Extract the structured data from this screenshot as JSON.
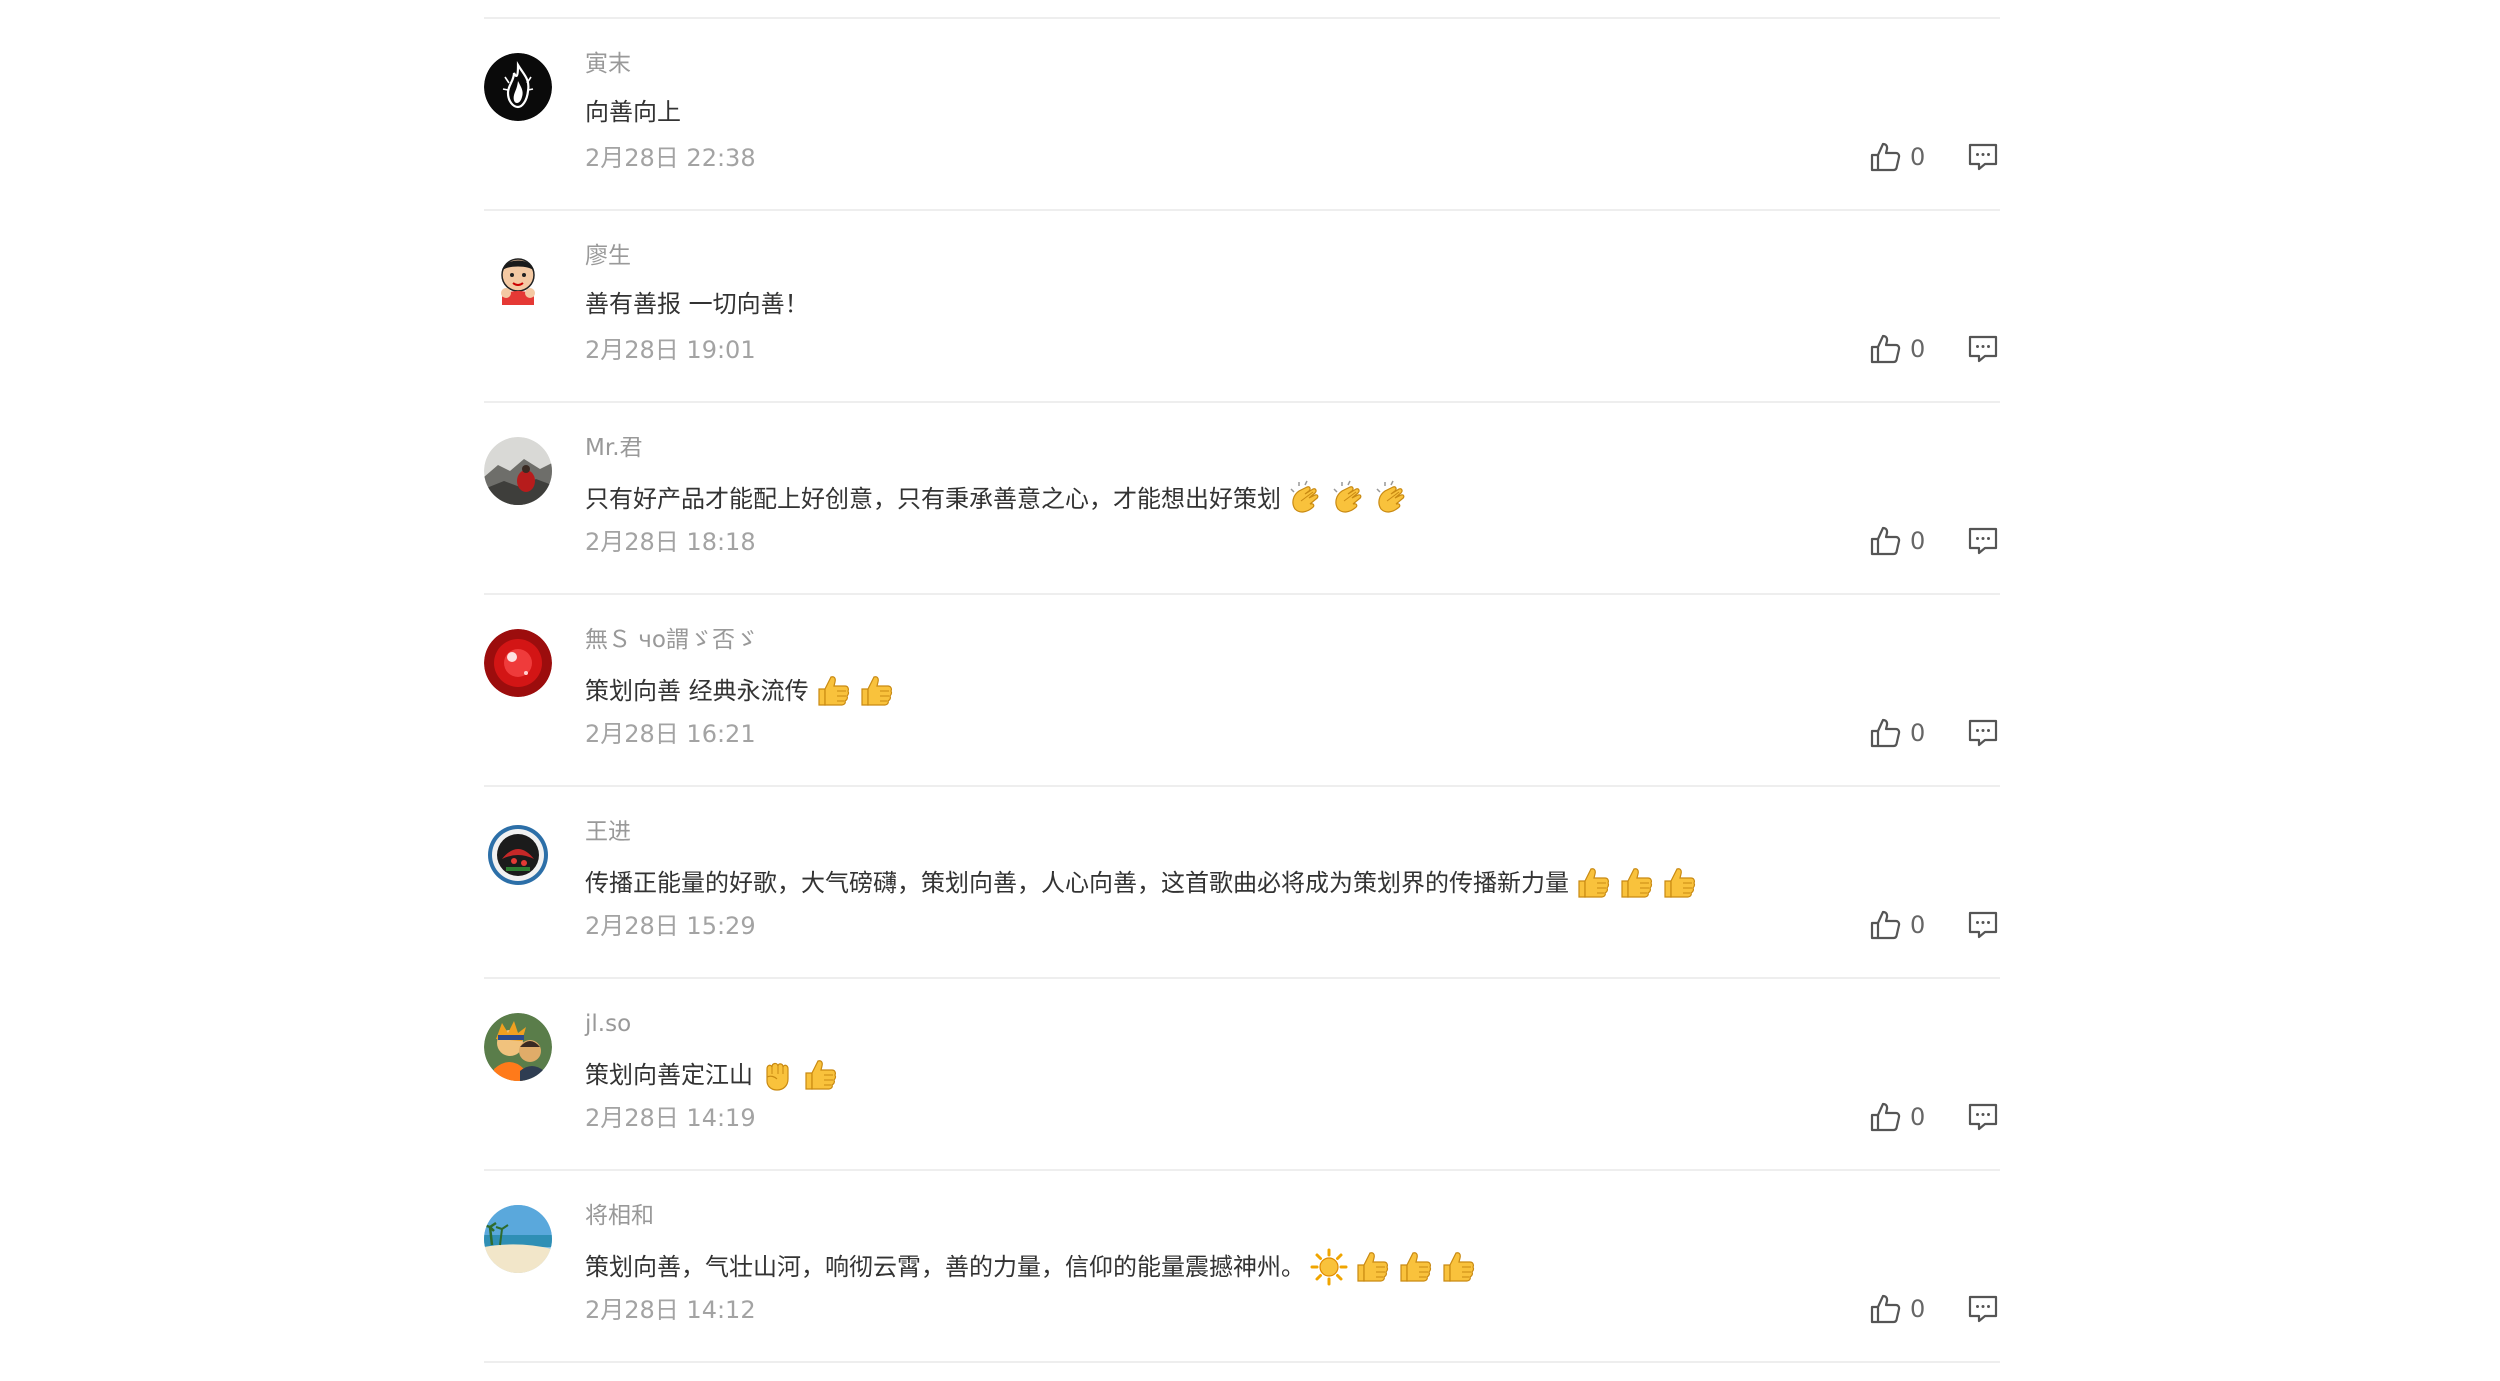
{
  "comments": [
    {
      "username": "寅末",
      "content": "向善向上",
      "emojis": [],
      "time": "2月28日 22:38",
      "likes": "0",
      "avatar": "avatar-flame"
    },
    {
      "username": "廖生",
      "content": "善有善报 一切向善！",
      "emojis": [],
      "time": "2月28日 19:01",
      "likes": "0",
      "avatar": "avatar-cartoon-boy"
    },
    {
      "username": "Mr.君",
      "content": "只有好产品才能配上好创意，只有秉承善意之心，才能想出好策划",
      "emojis": [
        "clap",
        "clap",
        "clap"
      ],
      "time": "2月28日 18:18",
      "likes": "0",
      "avatar": "avatar-landscape-red"
    },
    {
      "username": "無Ｓ чo謂ゞ否ゞ",
      "content": "策划向善 经典永流传",
      "emojis": [
        "thumbs-up",
        "thumbs-up"
      ],
      "time": "2月28日 16:21",
      "likes": "0",
      "avatar": "avatar-red-sphere"
    },
    {
      "username": "王进",
      "content": "传播正能量的好歌，大气磅礴，策划向善，人心向善，这首歌曲必将成为策划界的传播新力量",
      "emojis": [
        "thumbs-up",
        "thumbs-up",
        "thumbs-up"
      ],
      "time": "2月28日 15:29",
      "likes": "0",
      "avatar": "avatar-badge"
    },
    {
      "username": "jl.so",
      "content": "策划向善定江山",
      "emojis": [
        "fist",
        "thumbs-up"
      ],
      "time": "2月28日 14:19",
      "likes": "0",
      "avatar": "avatar-anime"
    },
    {
      "username": "将相和",
      "content": "策划向善，气壮山河，响彻云霄，善的力量，信仰的能量震撼神州。",
      "emojis": [
        "sun",
        "thumbs-up",
        "thumbs-up",
        "thumbs-up"
      ],
      "time": "2月28日 14:12",
      "likes": "0",
      "avatar": "avatar-beach"
    }
  ],
  "icons": {
    "like": "thumbs-up-outline-icon",
    "reply": "comment-bubble-icon"
  },
  "colors": {
    "username": "#999999",
    "content": "#333333",
    "time": "#a3a3a3",
    "divider": "#eeeeee",
    "icon": "#555555"
  }
}
